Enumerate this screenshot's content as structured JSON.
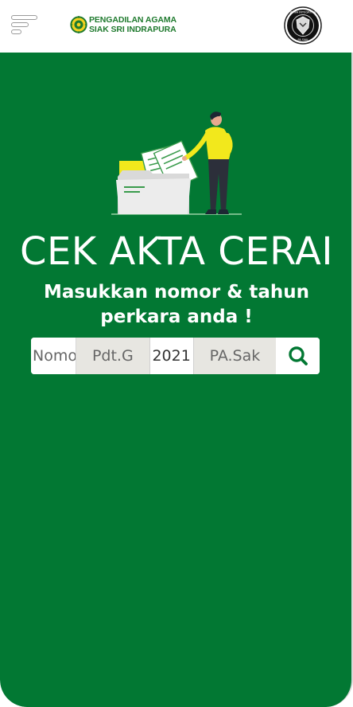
{
  "header": {
    "brand_line1": "PENGADILAN AGAMA",
    "brand_line2": "SIAK SRI INDRAPURA",
    "badge_text_top": "ZONA INTEGRITAS",
    "badge_text_bottom": "PA SIAK"
  },
  "hero": {
    "title": "CEK AKTA CERAI",
    "subtitle": "Masukkan nomor & tahun perkara anda !"
  },
  "search": {
    "number_placeholder": "Nomor",
    "case_type": "Pdt.G",
    "year_value": "2021",
    "court_code": "PA.Sak",
    "search_icon": "search-icon"
  },
  "colors": {
    "primary_green": "#027833",
    "brand_text_green": "#1f7a2e",
    "person_shirt": "#f2e81c"
  }
}
